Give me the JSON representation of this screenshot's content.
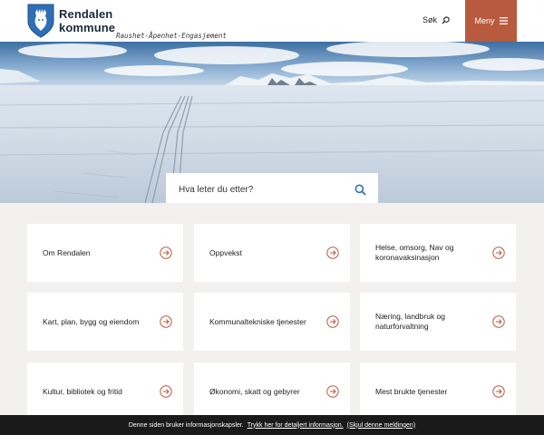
{
  "header": {
    "brand_line1": "Rendalen",
    "brand_line2": "kommune",
    "motto": "Raushet-Åpenhet-Engasjement",
    "search_label": "Søk",
    "menu_label": "Meny",
    "brand_color": "#b85a3e",
    "logo_color": "#2f6fb5"
  },
  "hero": {
    "search_placeholder": "Hva leter du etter?",
    "search_icon": "magnifier-icon"
  },
  "cards": [
    {
      "label": "Om Rendalen"
    },
    {
      "label": "Oppvekst"
    },
    {
      "label": "Helse, omsorg, Nav og koronavaksinasjon"
    },
    {
      "label": "Kart, plan, bygg og eiendom"
    },
    {
      "label": "Kommunaltekniske tjenester"
    },
    {
      "label": "Næring, landbruk og naturforvaltning"
    },
    {
      "label": "Kultur, bibliotek og fritid"
    },
    {
      "label": "Økonomi, skatt og gebyrer"
    },
    {
      "label": "Mest brukte tjenester"
    }
  ],
  "cookie": {
    "text": "Denne siden bruker informasjonskapsler.",
    "details_link": "Trykk her for detaljert informasjon.",
    "hide_link": "(Skjul denne meldingen)"
  }
}
